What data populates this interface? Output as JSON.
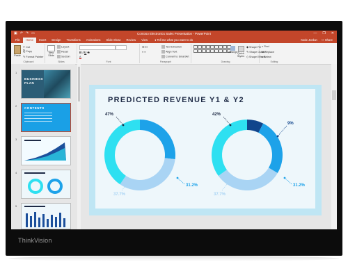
{
  "monitor": {
    "brand": "ThinkVision"
  },
  "window": {
    "title": "Contoso Electronics Sales Presentation - PowerPoint",
    "controls": [
      "—",
      "❐",
      "✕"
    ]
  },
  "tabs": [
    "File",
    "Home",
    "Insert",
    "Design",
    "Transitions",
    "Animations",
    "Slide Show",
    "Review",
    "View"
  ],
  "active_tab": "Home",
  "tell_me": "Tell me what you want to do",
  "user": {
    "name": "Katie Jordan",
    "share": "Share"
  },
  "ribbon": {
    "clipboard": {
      "label": "Clipboard",
      "paste": "Paste",
      "cut": "Cut",
      "copy": "Copy",
      "format_painter": "Format Painter"
    },
    "slides": {
      "label": "Slides",
      "new_slide": "New Slide",
      "layout": "Layout",
      "reset": "Reset",
      "section": "Section"
    },
    "font": {
      "label": "Font"
    },
    "paragraph": {
      "label": "Paragraph",
      "text_direction": "Text Direction",
      "align_text": "Align Text",
      "convert_smartart": "Convert to SmartArt"
    },
    "drawing": {
      "label": "Drawing",
      "arrange": "Arrange",
      "quick_styles": "Quick Styles",
      "shape_fill": "Shape Fill",
      "shape_outline": "Shape Outline",
      "shape_effects": "Shape Effects"
    },
    "editing": {
      "label": "Editing",
      "find": "Find",
      "replace": "Replace",
      "select": "Select"
    }
  },
  "thumbnails": [
    {
      "num": "1",
      "title": "BUSINESS PLAN"
    },
    {
      "num": "2",
      "title": "CONTENTS"
    },
    {
      "num": "3",
      "title": ""
    },
    {
      "num": "4",
      "title": ""
    },
    {
      "num": "5",
      "title": ""
    }
  ],
  "slide": {
    "title": "PREDICTED REVENUE Y1 & Y2",
    "donut_left": {
      "top_label": "47%",
      "right_label": "31.2%",
      "bottom_label": "37.7%"
    },
    "donut_right": {
      "top_left_label": "42%",
      "top_right_label": "9%",
      "right_label": "31.2%",
      "bottom_label": "37.7%"
    }
  },
  "chart_data": [
    {
      "type": "pie",
      "title": "",
      "values": [
        31.2,
        37.7,
        47
      ],
      "labels": [
        "31.2%",
        "37.7%",
        "47%"
      ],
      "colors": [
        "#1da2e9",
        "#a9d4f4",
        "#2ee0f1"
      ]
    },
    {
      "type": "pie",
      "title": "",
      "values": [
        9,
        31.2,
        37.7,
        42
      ],
      "labels": [
        "9%",
        "31.2%",
        "37.7%",
        "42%"
      ],
      "colors": [
        "#11458c",
        "#1da2e9",
        "#a9d4f4",
        "#2ee0f1"
      ]
    }
  ],
  "colors": {
    "accent": "#c3462a",
    "slide_bg": "#bfe6f4",
    "title": "#1e2a45"
  }
}
